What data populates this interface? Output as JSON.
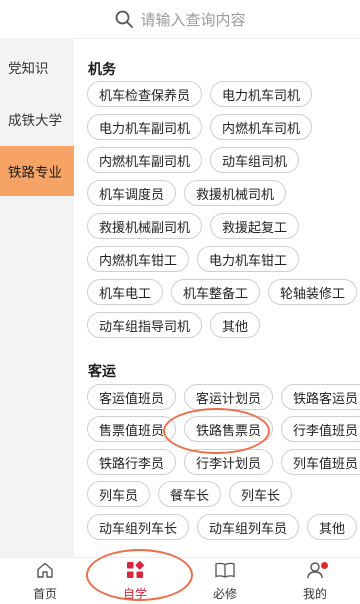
{
  "search": {
    "placeholder": "请输入查询内容"
  },
  "sidebar": {
    "items": [
      {
        "label": "党知识"
      },
      {
        "label": "成铁大学"
      },
      {
        "label": "铁路专业"
      }
    ]
  },
  "sections": [
    {
      "title": "机务",
      "rows": [
        [
          "机车检查保养员",
          "电力机车司机"
        ],
        [
          "电力机车副司机",
          "内燃机车司机"
        ],
        [
          "内燃机车副司机",
          "动车组司机"
        ],
        [
          "机车调度员",
          "救援机械司机"
        ],
        [
          "救援机械副司机",
          "救援起复工"
        ],
        [
          "内燃机车钳工",
          "电力机车钳工"
        ],
        [
          "机车电工",
          "机车整备工",
          "轮轴装修工"
        ],
        [
          "动车组指导司机",
          "其他"
        ]
      ]
    },
    {
      "title": "客运",
      "rows": [
        [
          "客运值班员",
          "客运计划员",
          "铁路客运员"
        ],
        [
          "售票值班员",
          "铁路售票员",
          "行李值班员"
        ],
        [
          "铁路行李员",
          "行李计划员",
          "列车值班员"
        ],
        [
          "列车员",
          "餐车长",
          "列车长"
        ],
        [
          "动车组列车长",
          "动车组列车员",
          "其他"
        ]
      ]
    }
  ],
  "tabbar": {
    "tabs": [
      {
        "label": "首页"
      },
      {
        "label": "自学"
      },
      {
        "label": "必修"
      },
      {
        "label": "我的"
      }
    ]
  },
  "colors": {
    "accent_sidebar": "#f6a465",
    "active_tab": "#d7263d",
    "annotation": "#ec6f4a"
  }
}
